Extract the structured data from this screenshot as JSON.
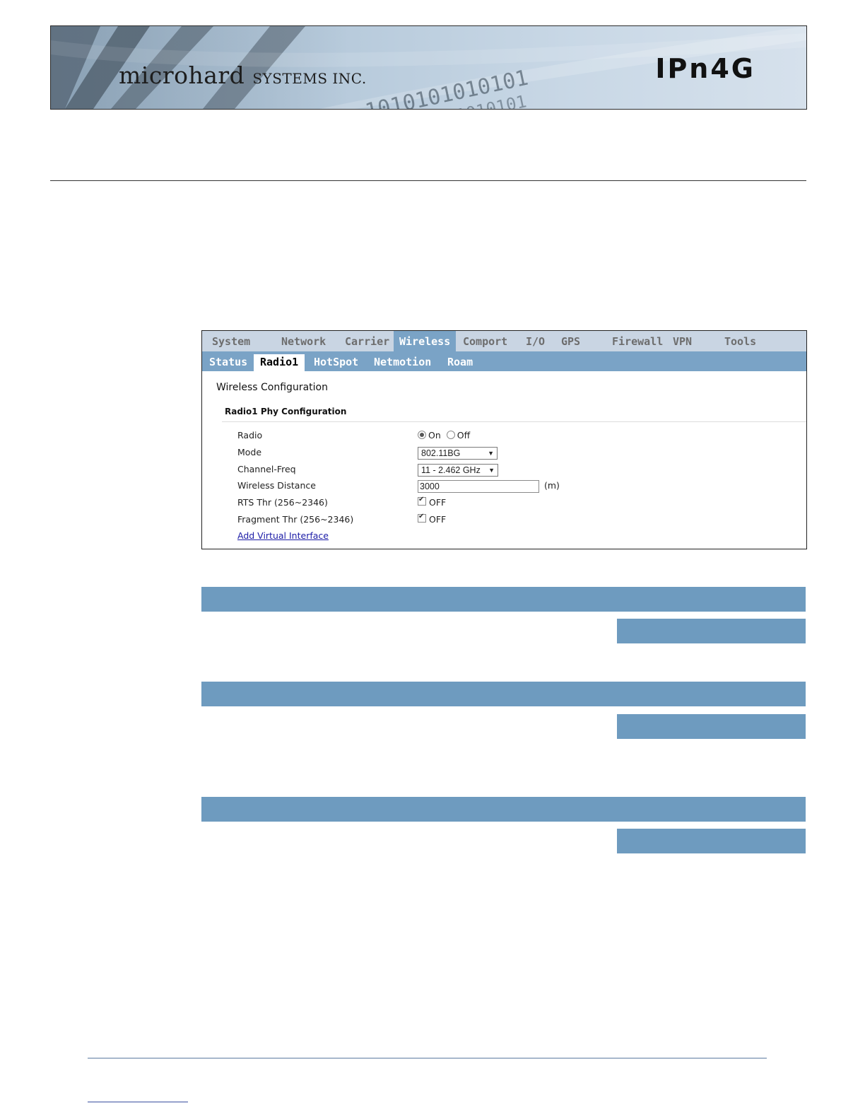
{
  "banner": {
    "brand": "microhard",
    "brand_suffix": "SYSTEMS INC.",
    "product": "IPn4G",
    "binary_text": "10101010101010",
    "colors": {
      "banner_bg": "#b8cbdc"
    }
  },
  "screenshot": {
    "nav_tabs": [
      {
        "label": "System"
      },
      {
        "label": "Network"
      },
      {
        "label": "Carrier"
      },
      {
        "label": "Wireless",
        "active": true
      },
      {
        "label": "Comport"
      },
      {
        "label": "I/O"
      },
      {
        "label": "GPS"
      },
      {
        "label": "Firewall"
      },
      {
        "label": "VPN"
      },
      {
        "label": "Tools"
      }
    ],
    "sub_tabs": [
      {
        "label": "Status"
      },
      {
        "label": "Radio1",
        "active": true
      },
      {
        "label": "HotSpot"
      },
      {
        "label": "Netmotion"
      },
      {
        "label": "Roam"
      }
    ],
    "section_title": "Wireless Configuration",
    "subsection_title": "Radio1 Phy Configuration",
    "fields": {
      "radio": {
        "label": "Radio",
        "on_label": "On",
        "off_label": "Off",
        "selected": "On"
      },
      "mode": {
        "label": "Mode",
        "value": "802.11BG"
      },
      "channel": {
        "label": "Channel-Freq",
        "value": "11 - 2.462 GHz"
      },
      "distance": {
        "label": "Wireless Distance",
        "value": "3000",
        "unit": "(m)"
      },
      "rts": {
        "label": "RTS Thr (256~2346)",
        "checked": true,
        "text": "OFF"
      },
      "fragment": {
        "label": "Fragment Thr (256~2346)",
        "checked": true,
        "text": "OFF"
      }
    },
    "link": "Add Virtual Interface",
    "colors": {
      "nav_bg": "#c9d5e3",
      "active_tab": "#7aa3c6",
      "link": "#1a1aa6"
    }
  },
  "page": {
    "colors": {
      "section_bar": "#6e9bbf"
    }
  }
}
